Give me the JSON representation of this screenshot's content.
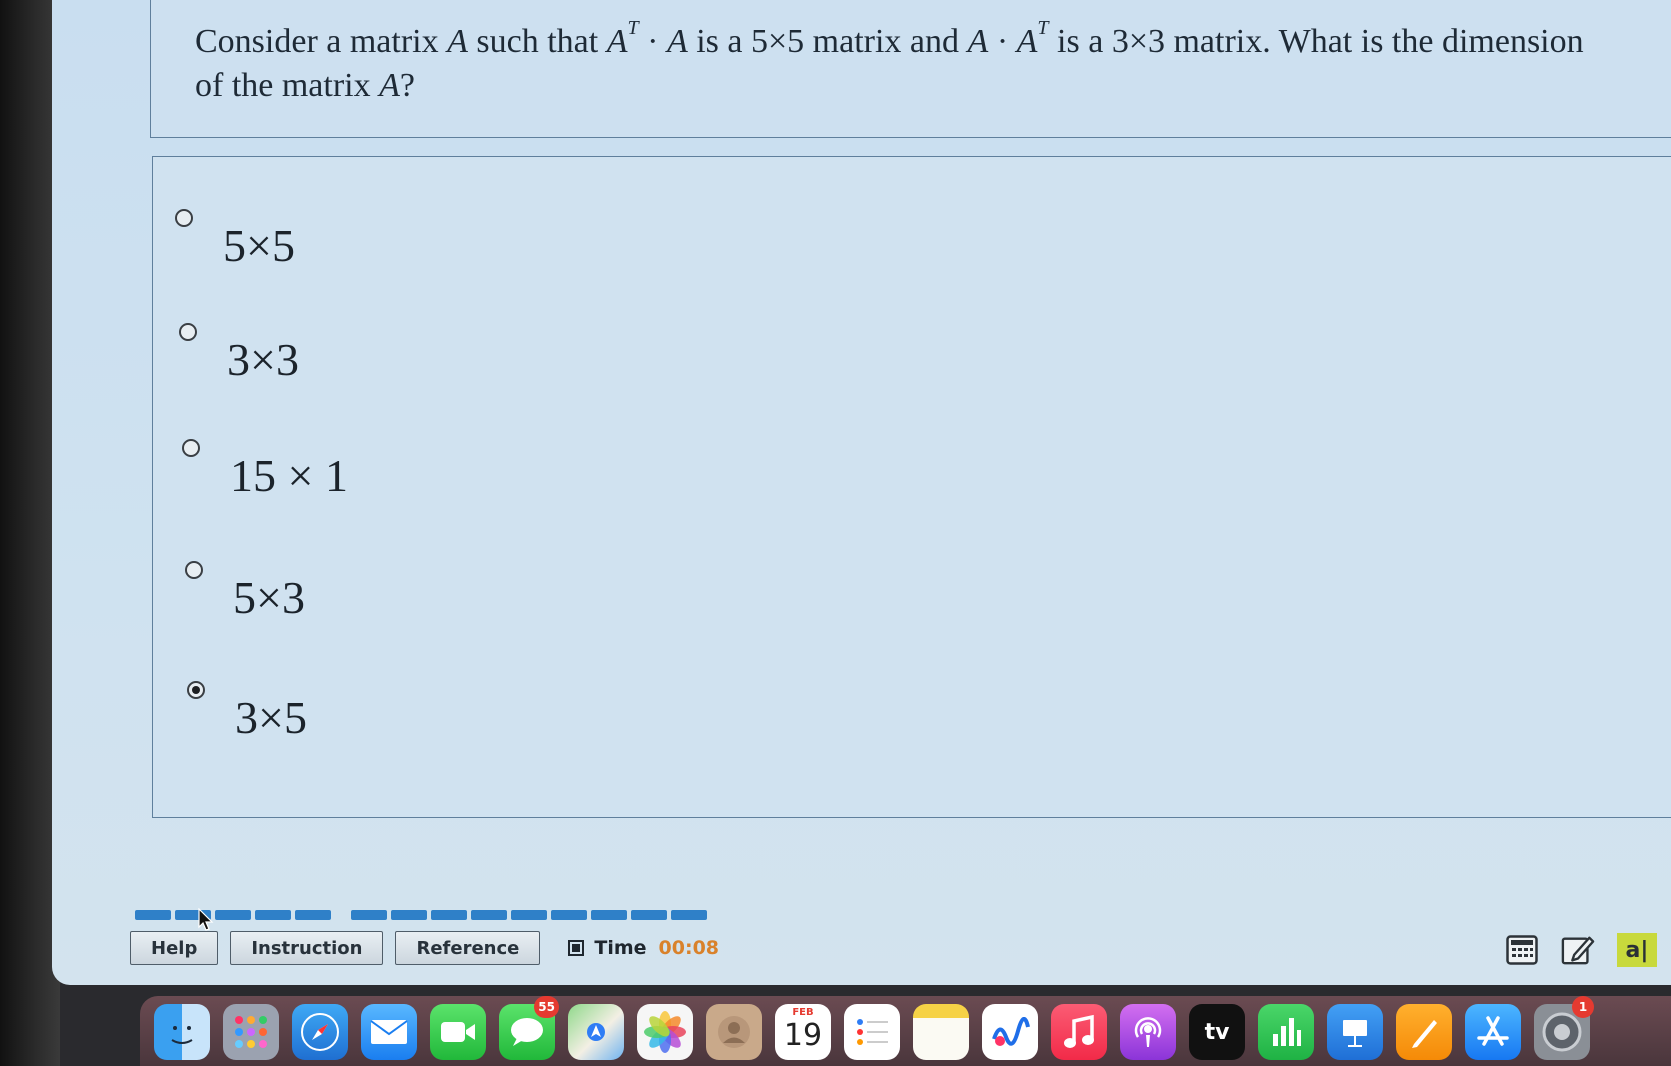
{
  "question": {
    "p1": "Consider a matrix ",
    "A": "A",
    "p2": " such that ",
    "sup_T": "T",
    "dot": " · ",
    "p3": " is a 5×5 matrix and ",
    "p4": " is a 3×3 matrix. What is the dimension of the matrix ",
    "p5": "?"
  },
  "options": [
    {
      "label": "5×5",
      "selected": false
    },
    {
      "label": "3×3",
      "selected": false
    },
    {
      "label": "15 × 1",
      "selected": false
    },
    {
      "label": "5×3",
      "selected": false
    },
    {
      "label": "3×5",
      "selected": true
    }
  ],
  "toolbar": {
    "help": "Help",
    "instruction": "Instruction",
    "reference": "Reference",
    "time_label": "Time",
    "time_value": "00:08"
  },
  "tools": {
    "calculator_icon": "calculator-icon",
    "notepad_icon": "edit-icon",
    "text_tool": "a|"
  },
  "dock": {
    "messages_badge": "55",
    "calendar_month": "FEB",
    "calendar_day": "19",
    "tv_label": "tv",
    "settings_badge": "1"
  },
  "colors": {
    "accent": "#2f80c8",
    "timer": "#d9822b"
  }
}
